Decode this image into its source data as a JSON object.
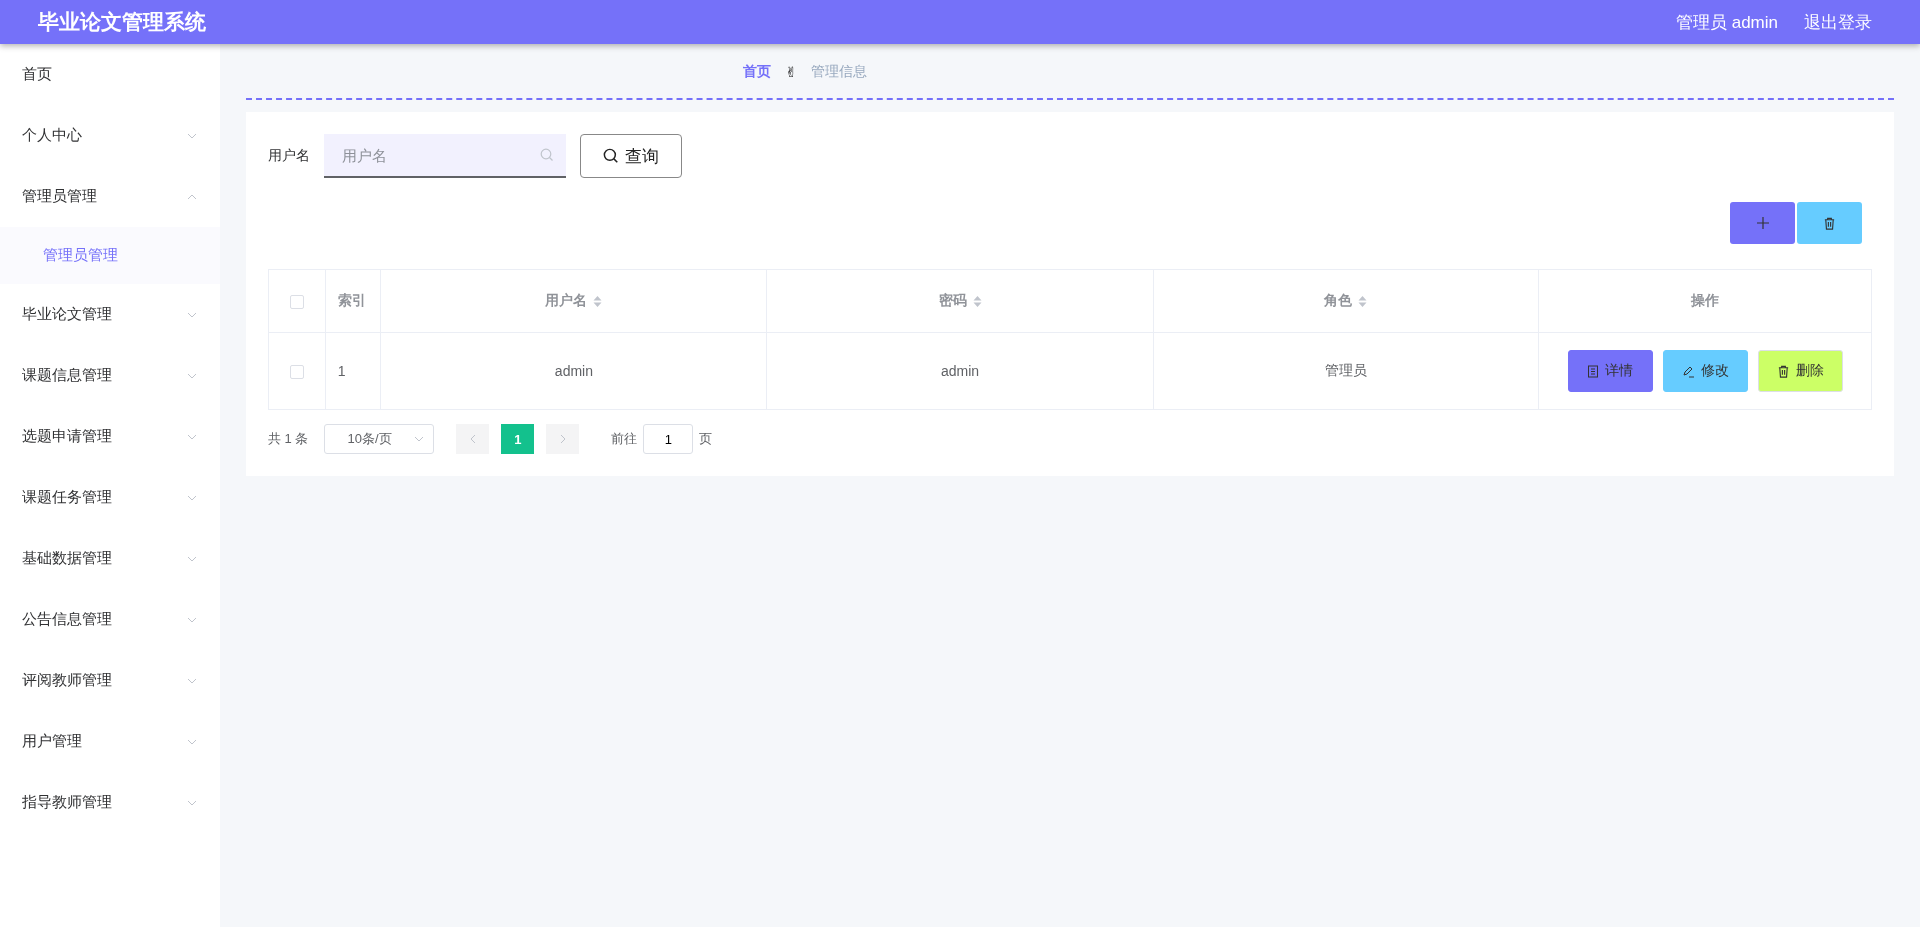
{
  "header": {
    "title": "毕业论文管理系统",
    "user": "管理员 admin",
    "logout": "退出登录"
  },
  "sidebar": {
    "items": [
      {
        "label": "首页"
      },
      {
        "label": "个人中心",
        "expandable": true,
        "expanded": false
      },
      {
        "label": "管理员管理",
        "expandable": true,
        "expanded": true,
        "children": [
          {
            "label": "管理员管理",
            "selected": true
          }
        ]
      },
      {
        "label": "毕业论文管理",
        "expandable": true,
        "expanded": false
      },
      {
        "label": "课题信息管理",
        "expandable": true,
        "expanded": false
      },
      {
        "label": "选题申请管理",
        "expandable": true,
        "expanded": false
      },
      {
        "label": "课题任务管理",
        "expandable": true,
        "expanded": false
      },
      {
        "label": "基础数据管理",
        "expandable": true,
        "expanded": false
      },
      {
        "label": "公告信息管理",
        "expandable": true,
        "expanded": false
      },
      {
        "label": "评阅教师管理",
        "expandable": true,
        "expanded": false
      },
      {
        "label": "用户管理",
        "expandable": true,
        "expanded": false
      },
      {
        "label": "指导教师管理",
        "expandable": true,
        "expanded": false
      }
    ]
  },
  "breadcrumb": {
    "items": [
      "首页",
      "管理信息"
    ],
    "separator": "✌"
  },
  "search": {
    "label": "用户名",
    "placeholder": "用户名",
    "button": "查询"
  },
  "table": {
    "columns": [
      {
        "label": "索引",
        "sortable": false
      },
      {
        "label": "用户名",
        "sortable": true
      },
      {
        "label": "密码",
        "sortable": true
      },
      {
        "label": "角色",
        "sortable": true
      },
      {
        "label": "操作",
        "sortable": false
      }
    ],
    "rows": [
      {
        "checked": false,
        "cells": [
          "1",
          "admin",
          "admin",
          "管理员"
        ]
      }
    ],
    "actions": [
      {
        "kind": "detail",
        "label": "详情"
      },
      {
        "kind": "edit",
        "label": "修改"
      },
      {
        "kind": "delete",
        "label": "删除"
      }
    ],
    "all_checked": false
  },
  "pagination": {
    "total": "共 1 条",
    "page_size": "10条/页",
    "pages": [
      {
        "label": "1",
        "selected": true
      }
    ],
    "goto_label": "前往",
    "goto_value": "1",
    "goto_suffix": "页"
  }
}
